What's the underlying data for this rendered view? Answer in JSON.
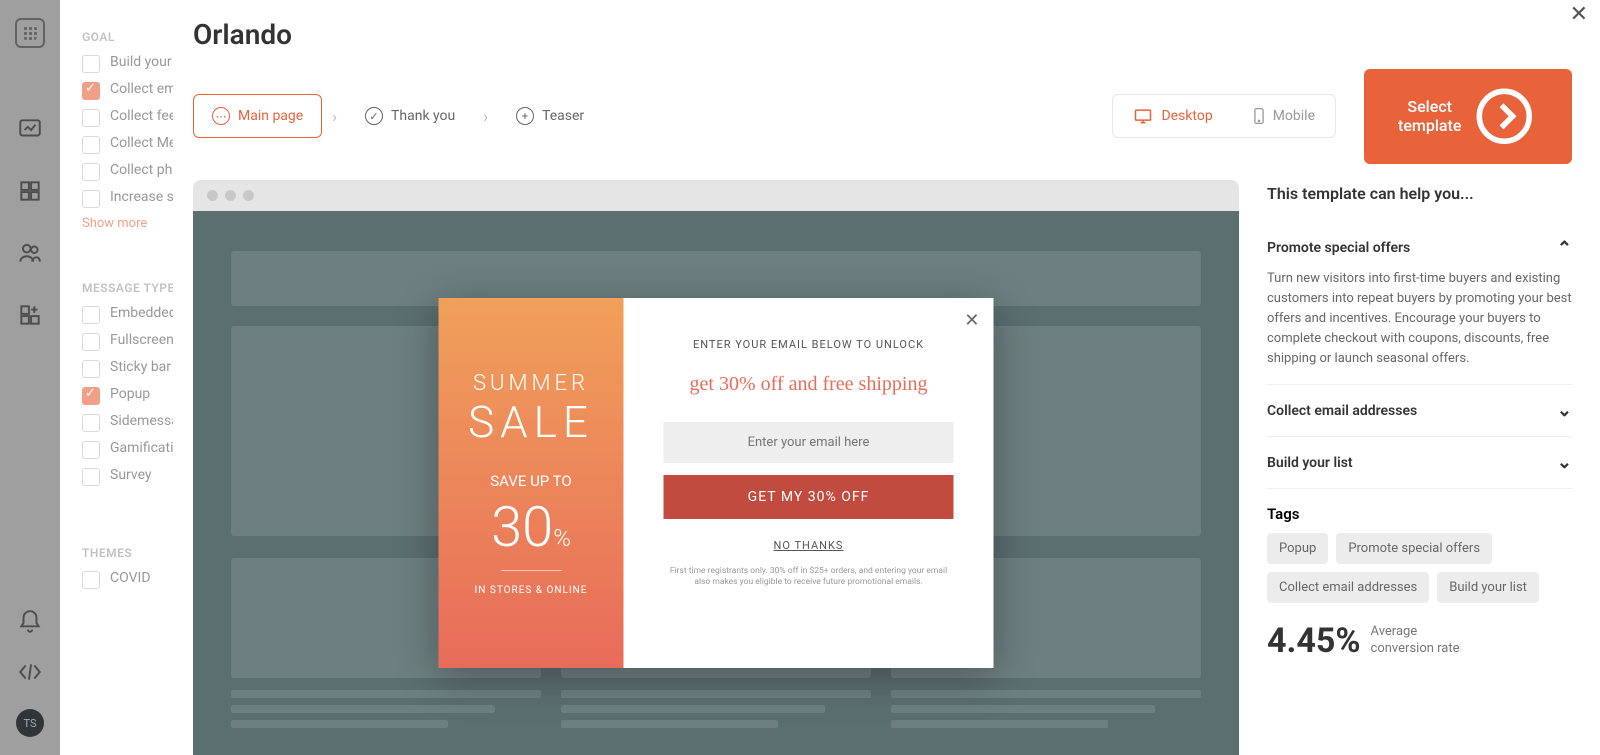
{
  "rail": {
    "avatar": "TS"
  },
  "sidebar": {
    "goal_title": "GOAL",
    "goals": [
      {
        "label": "Build your list",
        "checked": false
      },
      {
        "label": "Collect email addresses",
        "checked": true
      },
      {
        "label": "Collect feedback",
        "checked": false
      },
      {
        "label": "Collect Messenger subscribers",
        "checked": false
      },
      {
        "label": "Collect phone numbers",
        "checked": false
      },
      {
        "label": "Increase social engagement",
        "checked": false
      }
    ],
    "show_more": "Show more",
    "message_title": "MESSAGE TYPE",
    "messages": [
      {
        "label": "Embedded",
        "checked": false
      },
      {
        "label": "Fullscreen",
        "checked": false
      },
      {
        "label": "Sticky bar",
        "checked": false
      },
      {
        "label": "Popup",
        "checked": true
      },
      {
        "label": "Sidemessage",
        "checked": false
      },
      {
        "label": "Gamification",
        "checked": false
      },
      {
        "label": "Survey",
        "checked": false
      }
    ],
    "themes_title": "THEMES",
    "themes": [
      {
        "label": "COVID",
        "checked": false
      }
    ]
  },
  "main": {
    "title": "Orlando",
    "tabs": {
      "main": "Main page",
      "thankyou": "Thank you",
      "teaser": "Teaser"
    },
    "device": {
      "desktop": "Desktop",
      "mobile": "Mobile"
    },
    "select": "Select template"
  },
  "popup": {
    "left": {
      "l1": "SUMMER",
      "l2": "SALE",
      "l3": "SAVE UP TO",
      "l4": "30",
      "l4s": "%",
      "l5": "IN STORES & ONLINE"
    },
    "right": {
      "h1": "ENTER YOUR EMAIL BELOW TO UNLOCK",
      "h2": "get 30% off and free shipping",
      "placeholder": "Enter your email here",
      "btn": "GET MY 30% OFF",
      "no": "NO THANKS",
      "fine": "First time registrants only. 30% off in $25+ orders, and entering your email also makes you eligible to receive future promotional emails."
    }
  },
  "info": {
    "heading": "This template can help you...",
    "acc": [
      {
        "title": "Promote special offers",
        "body": "Turn new visitors into first-time buyers and existing customers into repeat buyers by promoting your best offers and incentives. Encourage your buyers to complete checkout with coupons, discounts, free shipping or launch seasonal offers.",
        "open": true
      },
      {
        "title": "Collect email addresses",
        "open": false
      },
      {
        "title": "Build your list",
        "open": false
      }
    ],
    "tags_title": "Tags",
    "tags": [
      "Popup",
      "Promote special offers",
      "Collect email addresses",
      "Build your list"
    ],
    "rate": "4.45%",
    "rate_label_1": "Average",
    "rate_label_2": "conversion rate"
  }
}
